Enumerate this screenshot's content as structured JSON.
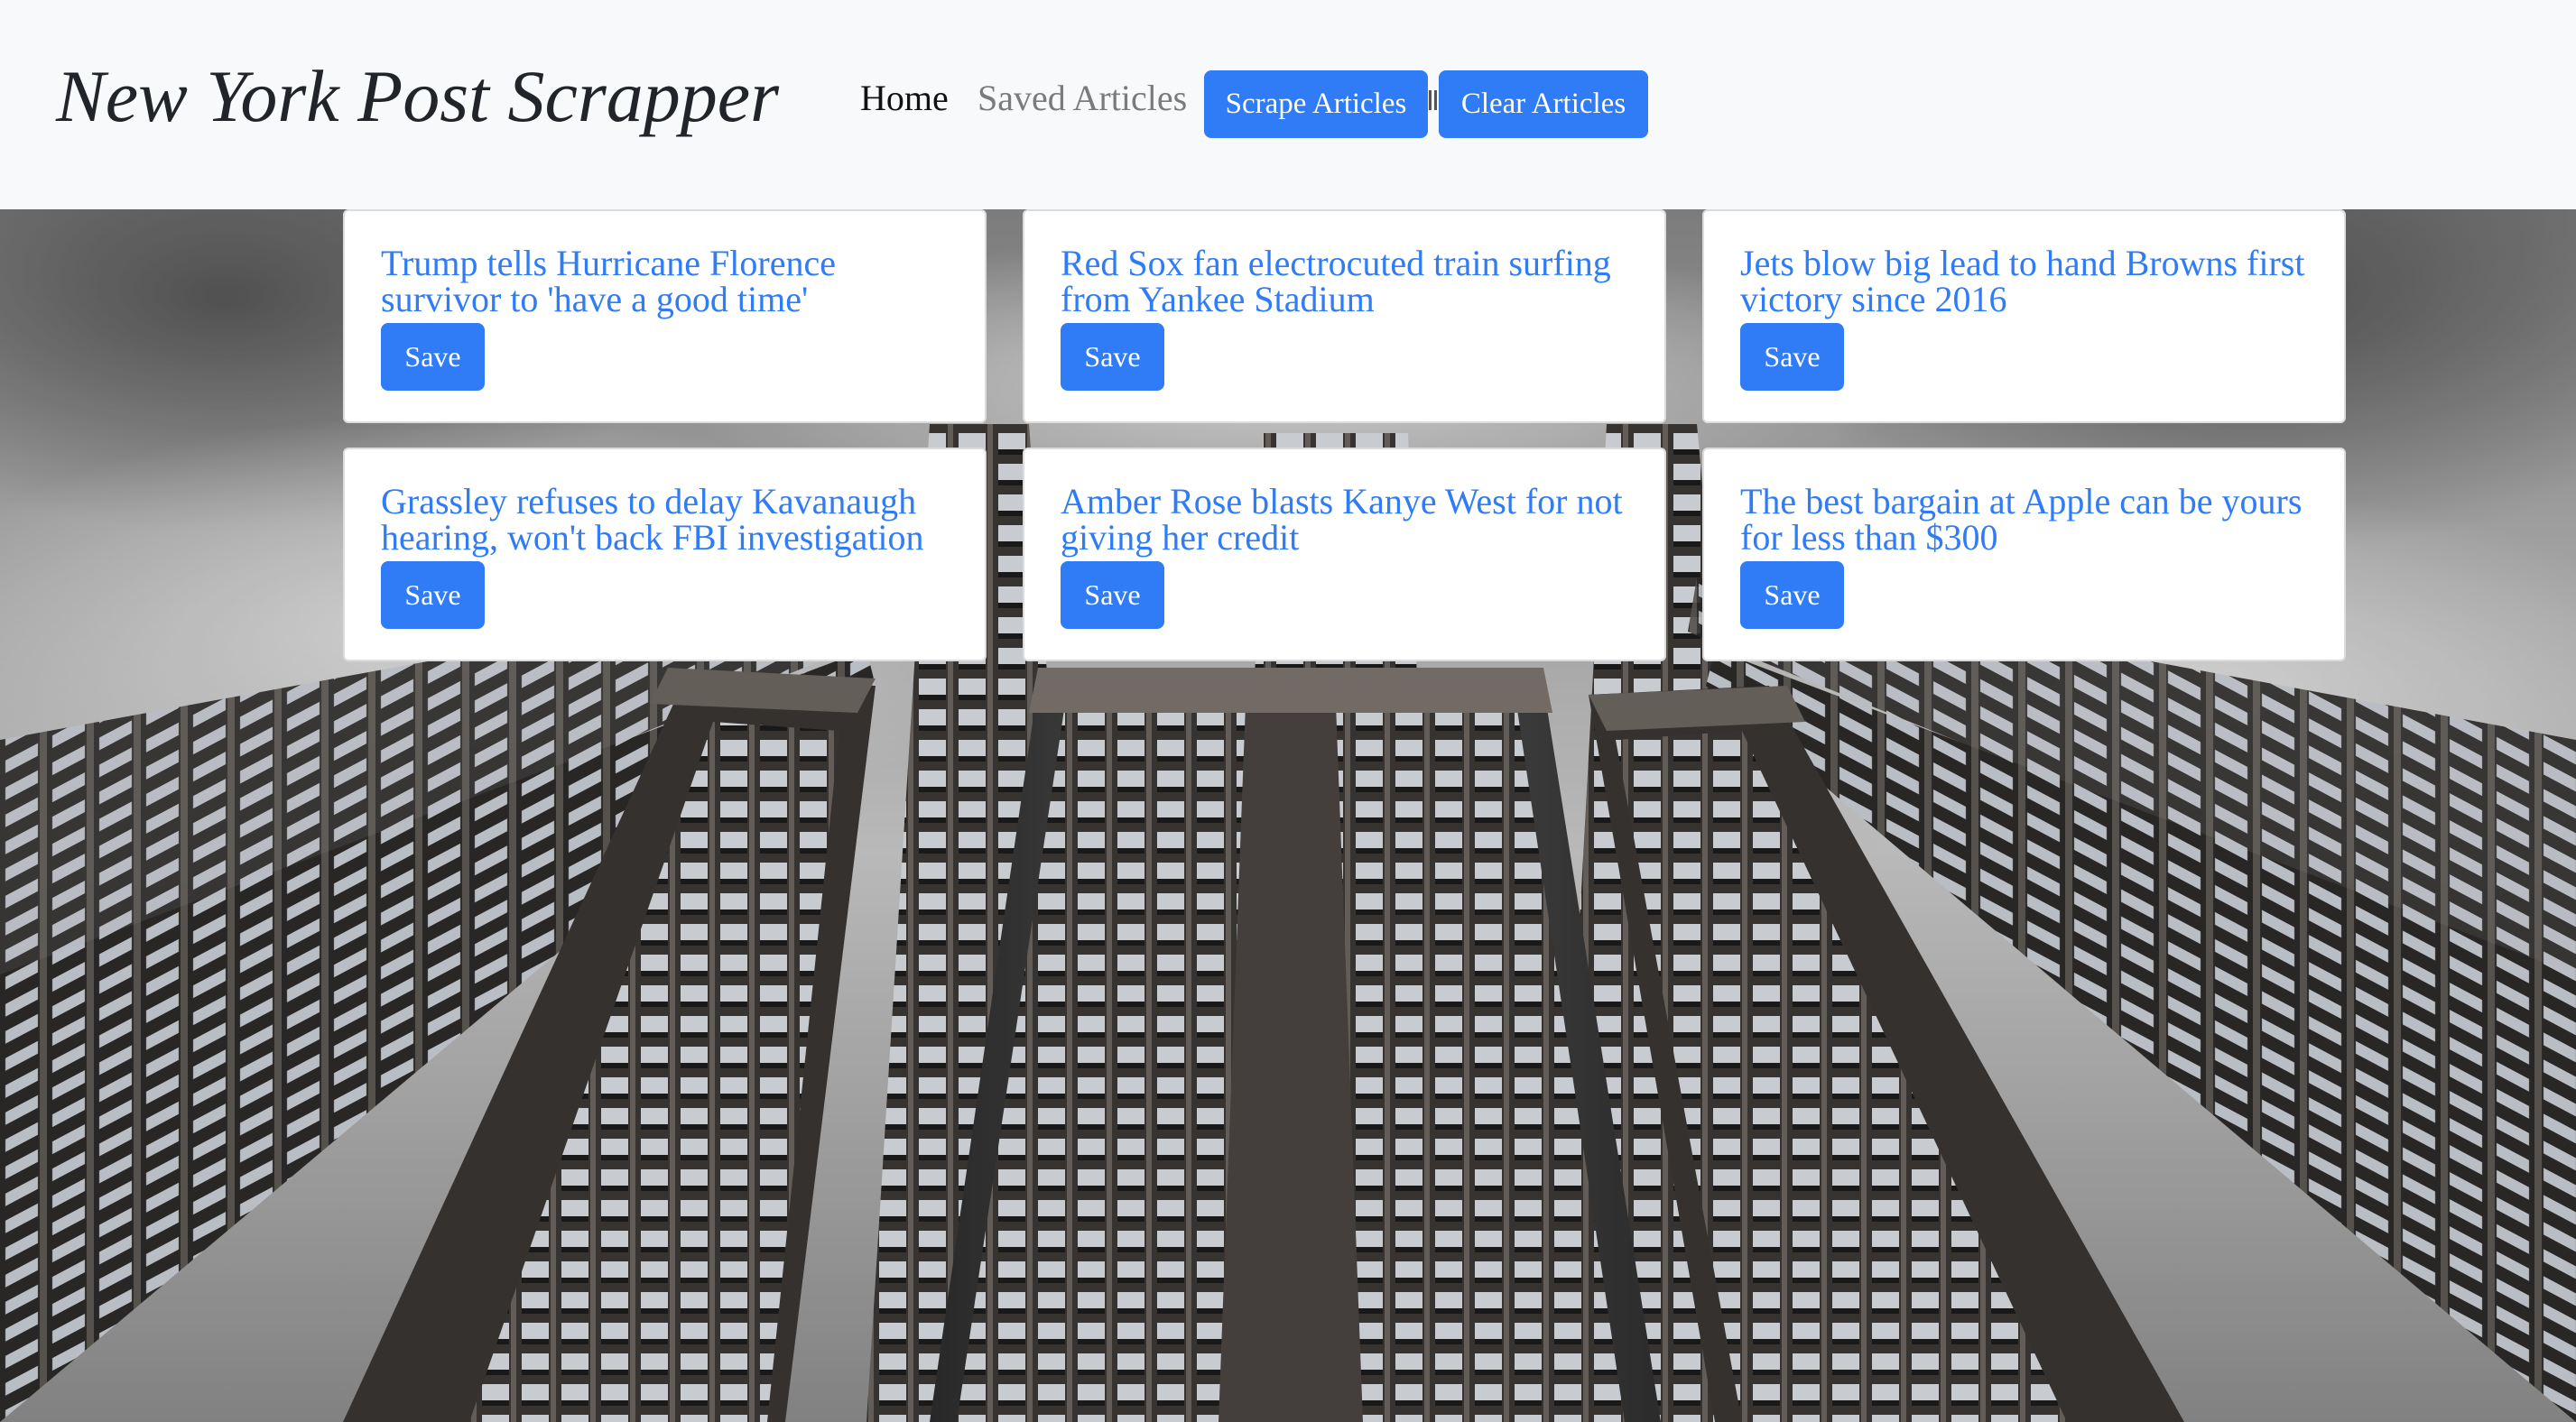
{
  "navbar": {
    "brand": "New York Post Scrapper",
    "home_label": "Home",
    "saved_label": "Saved Articles",
    "scrape_label": "Scrape Articles",
    "clear_label": "Clear Articles"
  },
  "articles": [
    {
      "title": "Trump tells Hurricane Florence survivor to 'have a good time'",
      "save_label": "Save"
    },
    {
      "title": "Red Sox fan electrocuted train surfing from Yankee Stadium",
      "save_label": "Save"
    },
    {
      "title": "Jets blow big lead to hand Browns first victory since 2016",
      "save_label": "Save"
    },
    {
      "title": "Grassley refuses to delay Kavanaugh hearing, won't back FBI investigation",
      "save_label": "Save"
    },
    {
      "title": "Amber Rose blasts Kanye West for not giving her credit",
      "save_label": "Save"
    },
    {
      "title": "The best bargain at Apple can be yours for less than $300",
      "save_label": "Save"
    }
  ],
  "colors": {
    "accent": "#2f7cf6",
    "navbar_bg": "#f8f9fa",
    "link_muted": "#7b7b7b"
  }
}
